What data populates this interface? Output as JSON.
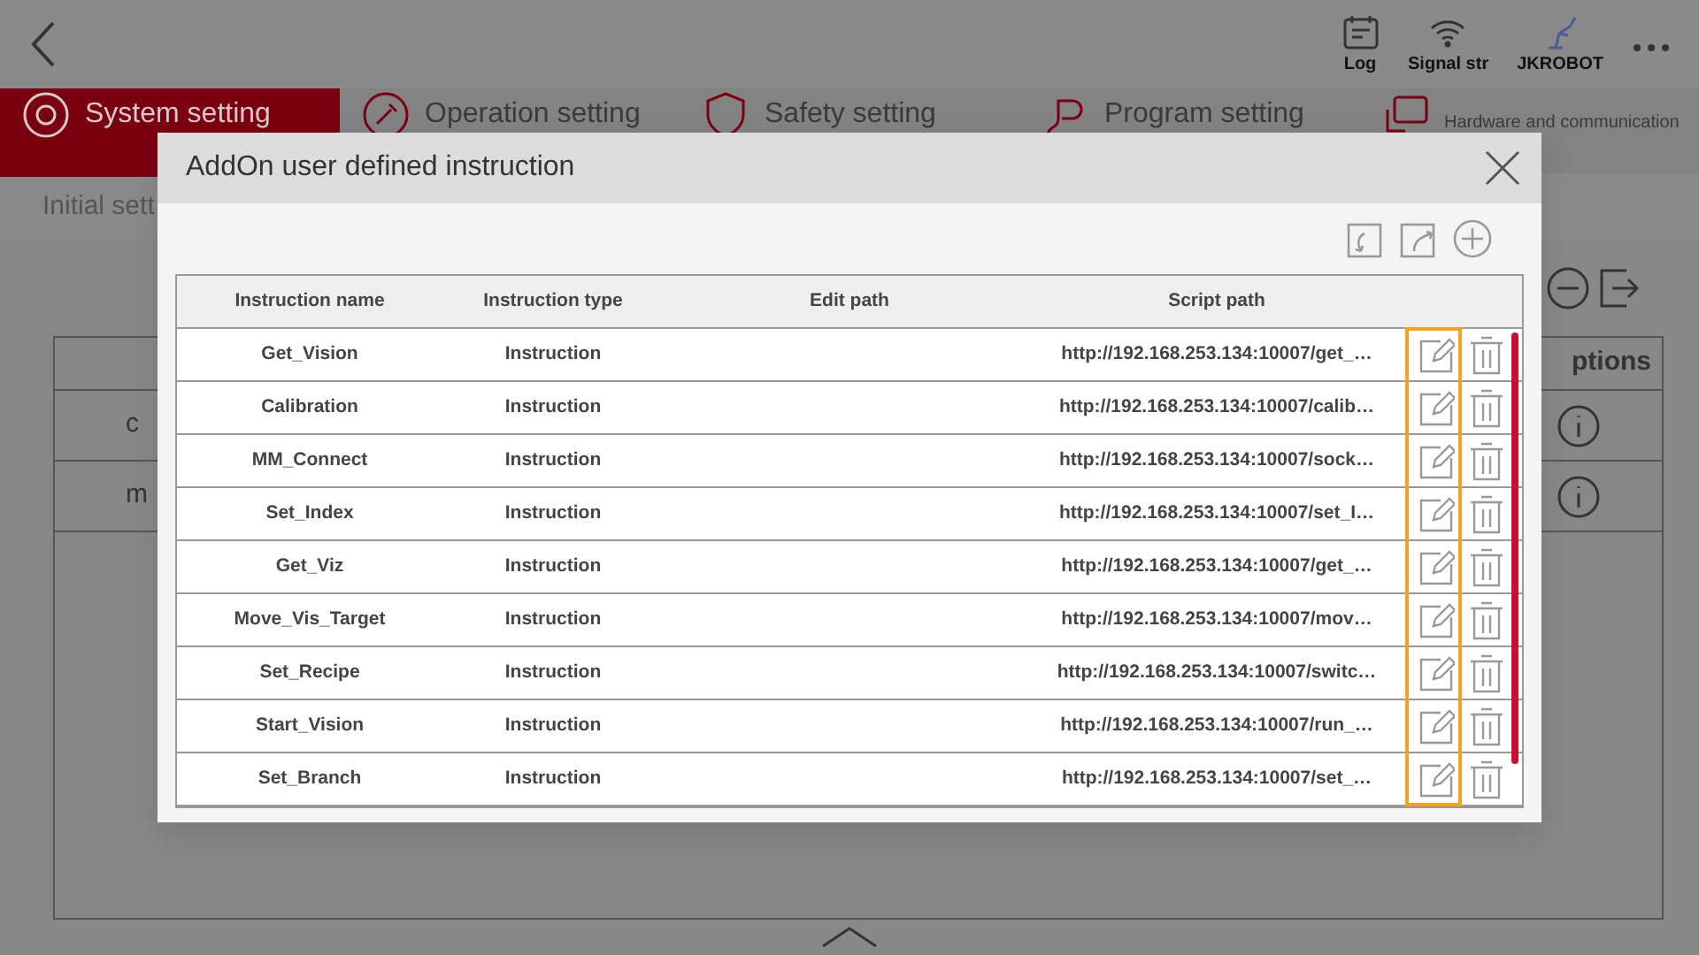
{
  "top_bar": {
    "items": [
      {
        "label": "Log"
      },
      {
        "label": "Signal str"
      },
      {
        "label": "JKROBOT"
      }
    ]
  },
  "tabs": [
    {
      "label": "System setting",
      "selected": true
    },
    {
      "label": "Operation setting",
      "selected": false
    },
    {
      "label": "Safety setting",
      "selected": false
    },
    {
      "label": "Program setting",
      "selected": false
    },
    {
      "label": "Hardware and communication",
      "selected": false
    }
  ],
  "sub_tab": "Initial sett",
  "background_table": {
    "header": "ptions",
    "rows": [
      "c",
      "m"
    ]
  },
  "dialog": {
    "title": "AddOn user defined instruction",
    "columns": [
      "Instruction name",
      "Instruction type",
      "Edit path",
      "Script path"
    ],
    "rows": [
      {
        "name": "Get_Vision",
        "type": "Instruction",
        "script_path": "http://192.168.253.134:10007/get_…"
      },
      {
        "name": "Calibration",
        "type": "Instruction",
        "script_path": "http://192.168.253.134:10007/calib…"
      },
      {
        "name": "MM_Connect",
        "type": "Instruction",
        "script_path": "http://192.168.253.134:10007/sock…"
      },
      {
        "name": "Set_Index",
        "type": "Instruction",
        "script_path": "http://192.168.253.134:10007/set_I…"
      },
      {
        "name": "Get_Viz",
        "type": "Instruction",
        "script_path": "http://192.168.253.134:10007/get_…"
      },
      {
        "name": "Move_Vis_Target",
        "type": "Instruction",
        "script_path": "http://192.168.253.134:10007/mov…"
      },
      {
        "name": "Set_Recipe",
        "type": "Instruction",
        "script_path": "http://192.168.253.134:10007/switc…"
      },
      {
        "name": "Start_Vision",
        "type": "Instruction",
        "script_path": "http://192.168.253.134:10007/run_…"
      },
      {
        "name": "Set_Branch",
        "type": "Instruction",
        "script_path": "http://192.168.253.134:10007/set_…"
      }
    ]
  }
}
